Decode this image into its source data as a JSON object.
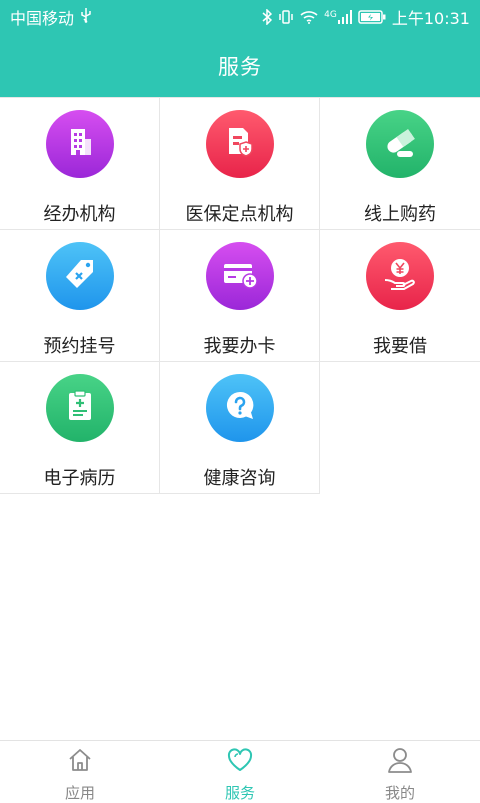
{
  "status_bar": {
    "carrier": "中国移动",
    "network": "4G",
    "time": "上午10:31"
  },
  "header": {
    "title": "服务"
  },
  "services": [
    {
      "label": "经办机构",
      "icon": "building-icon",
      "color_top": "#d64ef0",
      "color_bottom": "#9b27d8"
    },
    {
      "label": "医保定点机构",
      "icon": "insurance-document-icon",
      "color_top": "#ff5a6e",
      "color_bottom": "#e8244a"
    },
    {
      "label": "线上购药",
      "icon": "pill-capsule-icon",
      "color_top": "#48d387",
      "color_bottom": "#22b36a"
    },
    {
      "label": "预约挂号",
      "icon": "tag-icon",
      "color_top": "#4ec3f7",
      "color_bottom": "#1f95ec"
    },
    {
      "label": "我要办卡",
      "icon": "card-add-icon",
      "color_top": "#d64ef0",
      "color_bottom": "#9b27d8"
    },
    {
      "label": "我要借",
      "icon": "hand-yuan-icon",
      "color_top": "#ff5a6e",
      "color_bottom": "#e8244a"
    },
    {
      "label": "电子病历",
      "icon": "medical-record-icon",
      "color_top": "#48d387",
      "color_bottom": "#22b36a"
    },
    {
      "label": "健康咨询",
      "icon": "question-chat-icon",
      "color_top": "#4ec3f7",
      "color_bottom": "#1f95ec"
    }
  ],
  "bottom_nav": [
    {
      "label": "应用",
      "icon": "home-icon",
      "active": false
    },
    {
      "label": "服务",
      "icon": "heart-icon",
      "active": true
    },
    {
      "label": "我的",
      "icon": "user-icon",
      "active": false
    }
  ],
  "colors": {
    "primary": "#2ec6b3",
    "divider": "#e6e6e6",
    "nav_inactive": "#888888"
  }
}
